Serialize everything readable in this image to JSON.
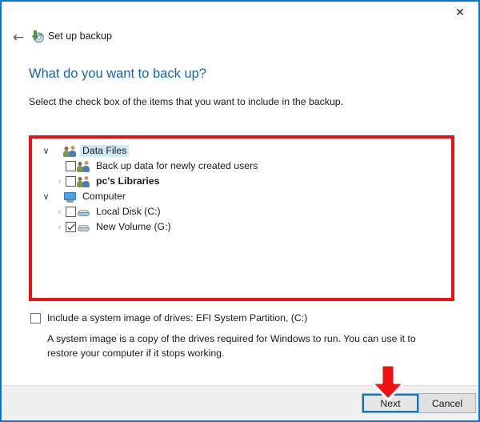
{
  "window": {
    "app_title": "Set up backup",
    "app_icon": "backup-disc-icon",
    "close_label": "✕",
    "back_label": "←",
    "accent_border": "#0078D7"
  },
  "page": {
    "heading": "What do you want to back up?",
    "subtitle": "Select the check box of the items that you want to include in the backup.",
    "heading_color": "#1464b4"
  },
  "tree": {
    "rows": [
      {
        "label": "Data Files",
        "depth": 0,
        "expander": "open",
        "checkbox": "none",
        "icon": "users-icon",
        "selected": true,
        "bold": false
      },
      {
        "label": "Back up data for newly created users",
        "depth": 1,
        "expander": "none",
        "checkbox": "unchecked",
        "icon": "users-icon",
        "selected": false,
        "bold": false
      },
      {
        "label": "pc's Libraries",
        "depth": 1,
        "expander": "closed",
        "checkbox": "unchecked",
        "icon": "users-icon",
        "selected": false,
        "bold": true
      },
      {
        "label": "Computer",
        "depth": 0,
        "expander": "open",
        "checkbox": "none",
        "icon": "monitor-icon",
        "selected": false,
        "bold": false
      },
      {
        "label": "Local Disk (C:)",
        "depth": 1,
        "expander": "closed",
        "checkbox": "unchecked",
        "icon": "disk-icon-blue",
        "selected": false,
        "bold": false
      },
      {
        "label": "New Volume (G:)",
        "depth": 1,
        "expander": "closed",
        "checkbox": "checked",
        "icon": "disk-icon",
        "selected": false,
        "bold": false
      }
    ]
  },
  "system_image": {
    "checkbox_label": "Include a system image of drives: EFI System Partition, (C:)",
    "checked": false,
    "description": "A system image is a copy of the drives required for Windows to run. You can use it to restore your computer if it stops working."
  },
  "footer": {
    "next_label": "Next",
    "cancel_label": "Cancel"
  },
  "annotations": {
    "highlight_color": "#ee1111",
    "arrow": "down-arrow-annotation",
    "rect": "tree-panel-highlight"
  }
}
